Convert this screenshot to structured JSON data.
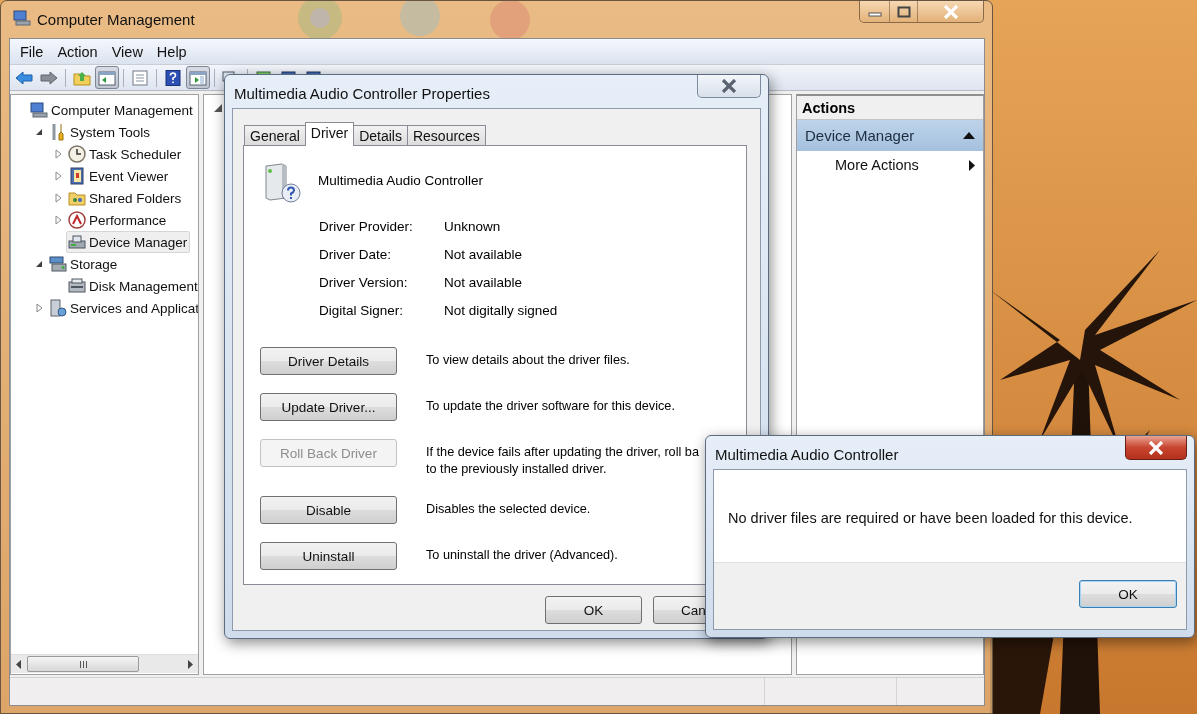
{
  "main_window": {
    "title": "Computer Management",
    "menu": [
      "File",
      "Action",
      "View",
      "Help"
    ],
    "toolbar": [
      {
        "pressed": false
      },
      {
        "pressed": false
      },
      {
        "pressed": false
      },
      {
        "pressed": true
      },
      {
        "pressed": false
      },
      {
        "pressed": false
      },
      {
        "pressed": true
      },
      {
        "pressed": false
      },
      {
        "pressed": false
      },
      {
        "pressed": false
      },
      {
        "pressed": false
      }
    ],
    "tree": [
      {
        "label": "Computer Management",
        "selected": false,
        "children": [
          {
            "label": "System Tools",
            "selected": false,
            "expanded": true,
            "children": [
              {
                "label": "Task Scheduler",
                "selected": false,
                "expanded": false
              },
              {
                "label": "Event Viewer",
                "selected": false,
                "expanded": false
              },
              {
                "label": "Shared Folders",
                "selected": false,
                "expanded": false
              },
              {
                "label": "Performance",
                "selected": false,
                "expanded": false
              },
              {
                "label": "Device Manager",
                "selected": true
              }
            ]
          },
          {
            "label": "Storage",
            "selected": false,
            "expanded": true,
            "children": [
              {
                "label": "Disk Management",
                "selected": false
              }
            ]
          },
          {
            "label": "Services and Applicat",
            "selected": false,
            "expanded": false
          }
        ]
      }
    ],
    "actions": {
      "title": "Actions",
      "section": {
        "label": "Device Manager",
        "expanded": true
      },
      "items": [
        {
          "label": "More Actions"
        }
      ]
    }
  },
  "properties_dialog": {
    "title": "Multimedia Audio Controller Properties",
    "tabs": [
      {
        "label": "General",
        "selected": false
      },
      {
        "label": "Driver",
        "selected": true
      },
      {
        "label": "Details",
        "selected": false
      },
      {
        "label": "Resources",
        "selected": false
      }
    ],
    "device_name": "Multimedia Audio Controller",
    "properties": [
      {
        "label": "Driver Provider:",
        "value": "Unknown"
      },
      {
        "label": "Driver Date:",
        "value": "Not available"
      },
      {
        "label": "Driver Version:",
        "value": "Not available"
      },
      {
        "label": "Digital Signer:",
        "value": "Not digitally signed"
      }
    ],
    "actions": [
      {
        "label": "Driver Details",
        "disabled": false,
        "description": [
          "To view details about the driver files."
        ]
      },
      {
        "label": "Update Driver...",
        "disabled": false,
        "description": [
          "To update the driver software for this device."
        ]
      },
      {
        "label": "Roll Back Driver",
        "disabled": true,
        "description": [
          "If the device fails after updating the driver, roll ba",
          "to the previously installed driver."
        ]
      },
      {
        "label": "Disable",
        "disabled": false,
        "description": [
          "Disables the selected device."
        ]
      },
      {
        "label": "Uninstall",
        "disabled": false,
        "description": [
          "To uninstall the driver (Advanced)."
        ]
      }
    ],
    "buttons": [
      {
        "label": "OK"
      },
      {
        "label": "Can"
      }
    ]
  },
  "message_box": {
    "title": "Multimedia Audio Controller",
    "message": "No driver files are required or have been loaded for this device.",
    "button": {
      "label": "OK",
      "default": true
    }
  }
}
